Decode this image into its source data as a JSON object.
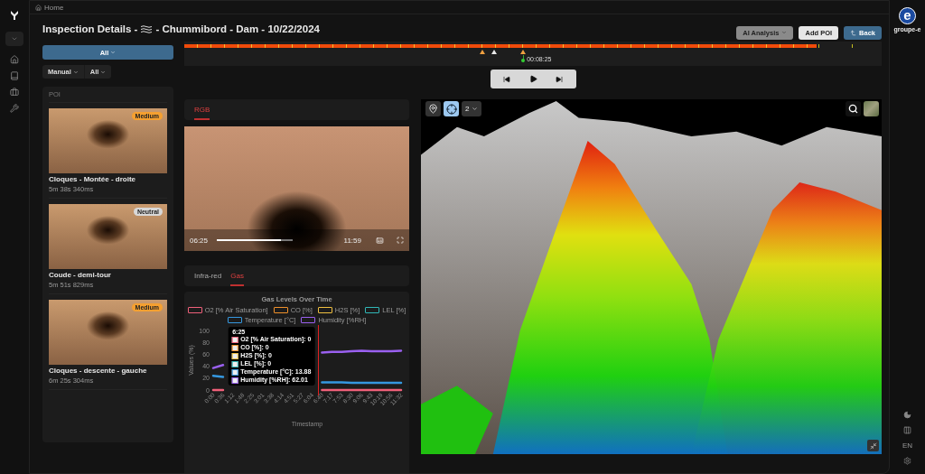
{
  "breadcrumb": {
    "label": "Home"
  },
  "title": {
    "prefix": "Inspection Details -",
    "suffix": "- Chummibord - Dam - 10/22/2024"
  },
  "header_buttons": [
    {
      "label": "AI Analysis",
      "kind": "dropdown"
    },
    {
      "label": "Add POI",
      "kind": "light"
    },
    {
      "label": "Back",
      "kind": "primary"
    }
  ],
  "filters": {
    "main": "All",
    "type": "Manual",
    "sub": "All"
  },
  "poi_panel": {
    "heading": "POI",
    "items": [
      {
        "title": "Cloques - Montée - droite",
        "time": "5m 38s 340ms",
        "badge": {
          "label": "Medium",
          "color": "#f5a030"
        }
      },
      {
        "title": "Coude - demi-tour",
        "time": "5m 51s 829ms",
        "badge": {
          "label": "Neutral",
          "color": "#d8d8d8"
        }
      },
      {
        "title": "Cloques - descente - gauche",
        "time": "6m 25s 304ms",
        "badge": {
          "label": "Medium",
          "color": "#f5a030"
        }
      }
    ]
  },
  "timeline": {
    "level": 0.907,
    "markers": [
      {
        "color": "#f0a040",
        "level": 0.427
      },
      {
        "color": "#e8e8e8",
        "level": 0.444
      },
      {
        "color": "#f0a040",
        "level": 0.486
      }
    ],
    "cursor": {
      "time": "00:08:25",
      "level": 0.486
    }
  },
  "video_tabs": [
    {
      "label": "RGB",
      "selected": true
    }
  ],
  "video": {
    "current": "06:25",
    "duration": "11:59",
    "level": 0.84
  },
  "sensor_tabs": [
    {
      "label": "Infra-red",
      "selected": false
    },
    {
      "label": "Gas",
      "selected": true
    }
  ],
  "gas_chart": {
    "chart_data": {
      "type": "line",
      "title": "Gas Levels Over Time",
      "xlabel": "Timestamp",
      "ylabel": "Values (%)",
      "categories": [
        "0:00",
        "0:36",
        "1:12",
        "1:48",
        "2:25",
        "3:01",
        "3:38",
        "4:14",
        "4:51",
        "5:27",
        "6:04",
        "6:40",
        "7:17",
        "7:53",
        "8:30",
        "9:06",
        "9:43",
        "10:19",
        "10:56",
        "11:32"
      ],
      "series": [
        {
          "name": "O2 [% Air Saturation]",
          "color": "#f0607a",
          "values": [
            0,
            0,
            null,
            null,
            null,
            null,
            null,
            null,
            null,
            null,
            null,
            0,
            0,
            0,
            0,
            0,
            0,
            0,
            0,
            0
          ]
        },
        {
          "name": "CO [%]",
          "color": "#f0902a",
          "values": [
            null,
            null,
            null,
            null,
            null,
            null,
            null,
            null,
            null,
            null,
            null,
            null,
            null,
            null,
            null,
            null,
            null,
            null,
            null,
            null
          ]
        },
        {
          "name": "H2S [%]",
          "color": "#f0c040",
          "values": [
            null,
            null,
            null,
            null,
            null,
            null,
            null,
            null,
            null,
            null,
            null,
            null,
            null,
            null,
            null,
            null,
            null,
            null,
            null,
            null
          ]
        },
        {
          "name": "LEL [%]",
          "color": "#30b8b8",
          "values": [
            null,
            null,
            null,
            null,
            null,
            null,
            null,
            null,
            null,
            null,
            null,
            null,
            null,
            null,
            null,
            null,
            null,
            null,
            null,
            null
          ]
        },
        {
          "name": "Temperature [°C]",
          "color": "#3598e0",
          "values": [
            24,
            22,
            null,
            null,
            null,
            null,
            null,
            null,
            null,
            null,
            null,
            13,
            13,
            13,
            12,
            12,
            12,
            12,
            12,
            12
          ]
        },
        {
          "name": "Humidity [%RH]",
          "color": "#9a60f0",
          "values": [
            37,
            42,
            null,
            null,
            null,
            null,
            null,
            null,
            null,
            null,
            null,
            63,
            64,
            64,
            65,
            66,
            65,
            65,
            65,
            66
          ]
        }
      ],
      "ylim": [
        0,
        100
      ],
      "yticks": [
        0,
        20,
        40,
        60,
        80,
        100
      ]
    },
    "tooltip": {
      "title": "6:25",
      "level": 0.56,
      "items": [
        {
          "label": "O2 [% Air Saturation]: 0",
          "color": "#f0607a"
        },
        {
          "label": "CO [%]: 0",
          "color": "#f0902a"
        },
        {
          "label": "H2S [%]: 0",
          "color": "#f0c040"
        },
        {
          "label": "LEL [%]: 0",
          "color": "#30b8b8"
        },
        {
          "label": "Temperature [°C]: 13.88",
          "color": "#3598e0"
        },
        {
          "label": "Humidity [%RH]: 62.01",
          "color": "#9a60f0"
        }
      ]
    }
  },
  "map": {
    "layer_select": "2",
    "tools": [
      {
        "kind": "pin",
        "selected": false
      },
      {
        "kind": "target",
        "selected": true
      }
    ]
  },
  "right_rail": {
    "logo_letter": "e",
    "brand": "groupe-e",
    "language": "EN"
  }
}
